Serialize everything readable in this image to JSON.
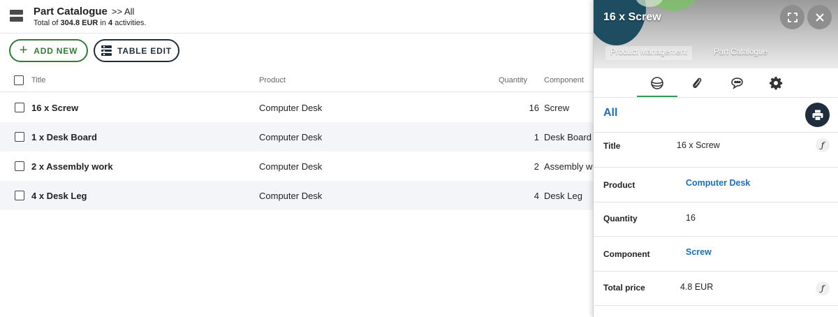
{
  "header": {
    "title": "Part Catalogue",
    "crumb": ">> All",
    "summary_prefix": "Total of ",
    "summary_amount": "304.8 EUR",
    "summary_mid": " in ",
    "summary_count": "4",
    "summary_suffix": " activities."
  },
  "toolbar": {
    "add_label": "ADD NEW",
    "table_edit_label": "TABLE EDIT"
  },
  "table": {
    "columns": [
      "Title",
      "Product",
      "Quantity",
      "Component"
    ],
    "rows": [
      {
        "title": "16 x Screw",
        "product": "Computer Desk",
        "quantity": "16",
        "component": "Screw"
      },
      {
        "title": "1 x Desk Board",
        "product": "Computer Desk",
        "quantity": "1",
        "component": "Desk Board"
      },
      {
        "title": "2 x Assembly work",
        "product": "Computer Desk",
        "quantity": "2",
        "component": "Assembly work"
      },
      {
        "title": "4 x Desk Leg",
        "product": "Computer Desk",
        "quantity": "4",
        "component": "Desk Leg"
      }
    ]
  },
  "panel": {
    "title": "16 x Screw",
    "breadcrumbs": [
      "Product Management",
      "Part Catalogue"
    ],
    "tabs": [
      "overview-icon",
      "attachment-icon",
      "comments-icon",
      "settings-icon"
    ],
    "view_label": "All",
    "fields": [
      {
        "label": "Title",
        "value": "16 x Screw"
      },
      {
        "label": "Product",
        "value": "Computer Desk"
      },
      {
        "label": "Quantity",
        "value": "16"
      },
      {
        "label": "Component",
        "value": "Screw"
      },
      {
        "label": "Total price",
        "value": "4.8 EUR"
      }
    ],
    "formula_glyph": "ƒ"
  },
  "colors": {
    "accent_green": "#2e7d32",
    "navy": "#1f2d3d",
    "link_blue": "#1a6fbf",
    "row_alt": "#f3f5f8"
  }
}
